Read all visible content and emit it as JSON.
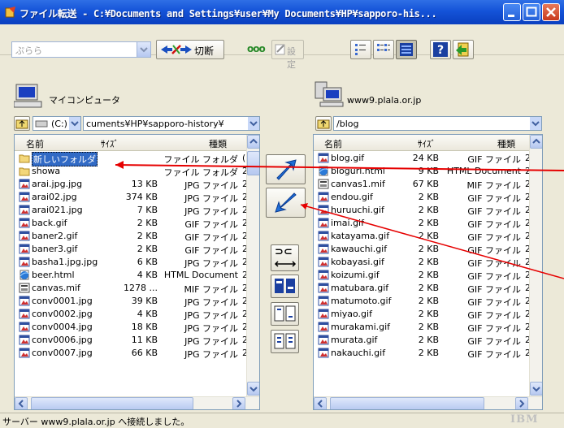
{
  "window": {
    "title": "ファイル転送 - C:¥Documents and Settings¥user¥My Documents¥HP¥sapporo-his..."
  },
  "toolbar": {
    "profile_combo": "ぷらら",
    "disconnect_label": "切断",
    "status_dots": "ooo",
    "settings_label": "設定"
  },
  "local": {
    "label": "マイコンピュータ",
    "drive": "(C:)",
    "path": "cuments¥HP¥sapporo-history¥",
    "columns": {
      "name": "名前",
      "size": "ｻｲｽﾞ",
      "type": "種類"
    },
    "files": [
      {
        "name": "新しいフォルダ",
        "size": "",
        "type": "ファイル フォルダ",
        "extra": "(",
        "icon": "folder"
      },
      {
        "name": "showa",
        "size": "",
        "type": "ファイル フォルダ",
        "extra": "2",
        "icon": "folder"
      },
      {
        "name": "arai.jpg.jpg",
        "size": "13 KB",
        "type": "JPG ファイル",
        "extra": "2",
        "icon": "image"
      },
      {
        "name": "arai02.jpg",
        "size": "374 KB",
        "type": "JPG ファイル",
        "extra": "2",
        "icon": "image"
      },
      {
        "name": "arai021.jpg",
        "size": "7 KB",
        "type": "JPG ファイル",
        "extra": "2",
        "icon": "image"
      },
      {
        "name": "back.gif",
        "size": "2 KB",
        "type": "GIF ファイル",
        "extra": "2",
        "icon": "image"
      },
      {
        "name": "baner2.gif",
        "size": "2 KB",
        "type": "GIF ファイル",
        "extra": "2",
        "icon": "image"
      },
      {
        "name": "baner3.gif",
        "size": "2 KB",
        "type": "GIF ファイル",
        "extra": "2",
        "icon": "image"
      },
      {
        "name": "basha1.jpg.jpg",
        "size": "6 KB",
        "type": "JPG ファイル",
        "extra": "2",
        "icon": "image"
      },
      {
        "name": "beer.html",
        "size": "4 KB",
        "type": "HTML Document",
        "extra": "2",
        "icon": "html"
      },
      {
        "name": "canvas.mif",
        "size": "1278 ...",
        "type": "MIF ファイル",
        "extra": "2",
        "icon": "mif"
      },
      {
        "name": "conv0001.jpg",
        "size": "39 KB",
        "type": "JPG ファイル",
        "extra": "2",
        "icon": "image"
      },
      {
        "name": "conv0002.jpg",
        "size": "4 KB",
        "type": "JPG ファイル",
        "extra": "2",
        "icon": "image"
      },
      {
        "name": "conv0004.jpg",
        "size": "18 KB",
        "type": "JPG ファイル",
        "extra": "2",
        "icon": "image"
      },
      {
        "name": "conv0006.jpg",
        "size": "11 KB",
        "type": "JPG ファイル",
        "extra": "2",
        "icon": "image"
      },
      {
        "name": "conv0007.jpg",
        "size": "66 KB",
        "type": "JPG ファイル",
        "extra": "2",
        "icon": "image"
      }
    ]
  },
  "remote": {
    "label": "www9.plala.or.jp",
    "path": "/blog",
    "columns": {
      "name": "名前",
      "size": "ｻｲｽﾞ",
      "type": "種類"
    },
    "files": [
      {
        "name": "blog.gif",
        "size": "24 KB",
        "type": "GIF ファイル",
        "extra": "2",
        "icon": "image"
      },
      {
        "name": "blogurl.html",
        "size": "9 KB",
        "type": "HTML Document",
        "extra": "2",
        "icon": "html"
      },
      {
        "name": "canvas1.mif",
        "size": "67 KB",
        "type": "MIF ファイル",
        "extra": "2",
        "icon": "mif"
      },
      {
        "name": "endou.gif",
        "size": "2 KB",
        "type": "GIF ファイル",
        "extra": "2",
        "icon": "image"
      },
      {
        "name": "huruuchi.gif",
        "size": "2 KB",
        "type": "GIF ファイル",
        "extra": "2",
        "icon": "image"
      },
      {
        "name": "imai.gif",
        "size": "2 KB",
        "type": "GIF ファイル",
        "extra": "2",
        "icon": "image"
      },
      {
        "name": "katayama.gif",
        "size": "2 KB",
        "type": "GIF ファイル",
        "extra": "2",
        "icon": "image"
      },
      {
        "name": "kawauchi.gif",
        "size": "2 KB",
        "type": "GIF ファイル",
        "extra": "2",
        "icon": "image"
      },
      {
        "name": "kobayasi.gif",
        "size": "2 KB",
        "type": "GIF ファイル",
        "extra": "2",
        "icon": "image"
      },
      {
        "name": "koizumi.gif",
        "size": "2 KB",
        "type": "GIF ファイル",
        "extra": "2",
        "icon": "image"
      },
      {
        "name": "matubara.gif",
        "size": "2 KB",
        "type": "GIF ファイル",
        "extra": "2",
        "icon": "image"
      },
      {
        "name": "matumoto.gif",
        "size": "2 KB",
        "type": "GIF ファイル",
        "extra": "2",
        "icon": "image"
      },
      {
        "name": "miyao.gif",
        "size": "2 KB",
        "type": "GIF ファイル",
        "extra": "2",
        "icon": "image"
      },
      {
        "name": "murakami.gif",
        "size": "2 KB",
        "type": "GIF ファイル",
        "extra": "2",
        "icon": "image"
      },
      {
        "name": "murata.gif",
        "size": "2 KB",
        "type": "GIF ファイル",
        "extra": "2",
        "icon": "image"
      },
      {
        "name": "nakauchi.gif",
        "size": "2 KB",
        "type": "GIF ファイル",
        "extra": "2",
        "icon": "image"
      }
    ]
  },
  "transfer": {
    "compare_symbol": "⊃⊂"
  },
  "status": {
    "text": "サーバー www9.plala.or.jp へ接続しました。",
    "brand": "IBM"
  },
  "colors": {
    "titlebar": "#1453d8",
    "annotation_arrow": "#e60000",
    "transfer_arrow": "#1f6fd8"
  }
}
